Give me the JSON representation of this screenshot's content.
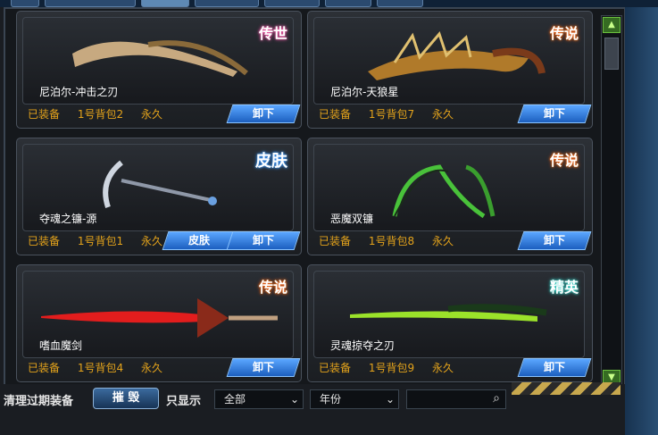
{
  "tabs": [
    "",
    "",
    "",
    "",
    "",
    "",
    ""
  ],
  "cards": [
    {
      "name": "尼泊尔-冲击之刃",
      "badge": "传世",
      "status": "已装备",
      "bag": "1号背包2",
      "duration": "永久",
      "unequip": "卸下",
      "skin": ""
    },
    {
      "name": "尼泊尔-天狼星",
      "badge": "传说",
      "status": "已装备",
      "bag": "1号背包7",
      "duration": "永久",
      "unequip": "卸下",
      "skin": ""
    },
    {
      "name": "夺魂之镰-源",
      "badge": "皮肤",
      "status": "已装备",
      "bag": "1号背包1",
      "duration": "永久",
      "unequip": "卸下",
      "skin": "皮肤"
    },
    {
      "name": "恶魔双镰",
      "badge": "传说",
      "status": "已装备",
      "bag": "1号背包8",
      "duration": "永久",
      "unequip": "卸下",
      "skin": ""
    },
    {
      "name": "嗜血魔剑",
      "badge": "传说",
      "status": "已装备",
      "bag": "1号背包4",
      "duration": "永久",
      "unequip": "卸下",
      "skin": ""
    },
    {
      "name": "灵魂掠夺之刃",
      "badge": "精英",
      "status": "已装备",
      "bag": "1号背包9",
      "duration": "永久",
      "unequip": "卸下",
      "skin": ""
    }
  ],
  "bottom": {
    "clean_label": "清理过期装备",
    "destroy_label": "摧 毁",
    "only_show_label": "只显示",
    "filter_all": "全部",
    "filter_year": "年份",
    "search_value": ""
  },
  "scroll": {
    "up": "▲",
    "down": "▼"
  }
}
